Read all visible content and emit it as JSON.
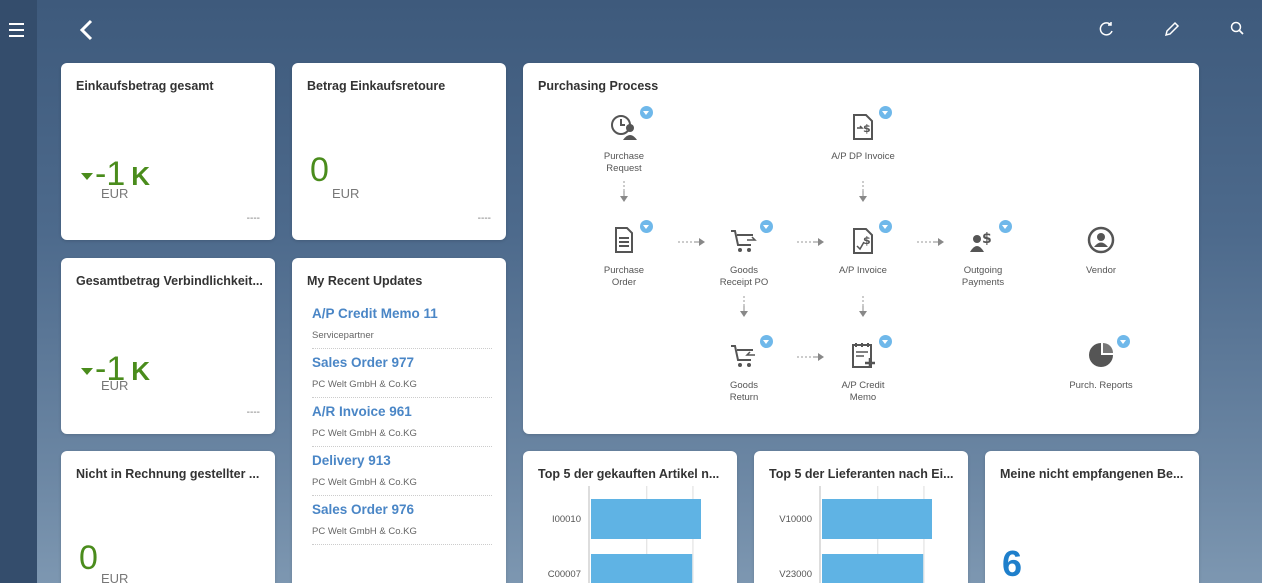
{
  "topbar": {
    "menu_icon": "hamburger-icon",
    "back_icon": "chevron-left-icon",
    "refresh_icon": "refresh-icon",
    "edit_icon": "pencil-icon",
    "search_icon": "search-icon"
  },
  "tiles": {
    "einkauf": {
      "title": "Einkaufsbetrag gesamt",
      "value": "-1",
      "scale": "K",
      "currency": "EUR",
      "footer": "----",
      "trend": "down"
    },
    "retoure": {
      "title": "Betrag Einkaufsretoure",
      "value": "0",
      "currency": "EUR",
      "footer": "----"
    },
    "verbind": {
      "title": "Gesamtbetrag Verbindlichkeit...",
      "value": "-1",
      "scale": "K",
      "currency": "EUR",
      "footer": "----",
      "trend": "down"
    },
    "nicht": {
      "title": "Nicht in Rechnung gestellter ...",
      "value": "0",
      "currency": "EUR"
    }
  },
  "recent": {
    "title": "My Recent Updates",
    "items": [
      {
        "title": "A/P Credit Memo 11",
        "sub": "Servicepartner"
      },
      {
        "title": "Sales Order 977",
        "sub": "PC Welt GmbH & Co.KG"
      },
      {
        "title": "A/R Invoice 961",
        "sub": "PC Welt GmbH & Co.KG"
      },
      {
        "title": "Delivery 913",
        "sub": "PC Welt GmbH & Co.KG"
      },
      {
        "title": "Sales Order 976",
        "sub": "PC Welt GmbH & Co.KG"
      }
    ]
  },
  "process": {
    "title": "Purchasing Process",
    "nodes": {
      "purchase_request": {
        "label": "Purchase\nRequest",
        "icon": "clock-person-icon"
      },
      "ap_dp_invoice": {
        "label": "A/P DP Invoice",
        "icon": "dp-invoice-icon"
      },
      "purchase_order": {
        "label": "Purchase\nOrder",
        "icon": "document-icon"
      },
      "goods_receipt": {
        "label": "Goods\nReceipt PO",
        "icon": "cart-in-icon"
      },
      "ap_invoice": {
        "label": "A/P Invoice",
        "icon": "invoice-icon"
      },
      "outgoing_payments": {
        "label": "Outgoing\nPayments",
        "icon": "payments-icon"
      },
      "vendor": {
        "label": "Vendor",
        "icon": "vendor-icon"
      },
      "goods_return": {
        "label": "Goods\nReturn",
        "icon": "cart-return-icon"
      },
      "ap_credit_memo": {
        "label": "A/P Credit\nMemo",
        "icon": "credit-memo-icon"
      },
      "purch_reports": {
        "label": "Purch. Reports",
        "icon": "pie-chart-icon"
      }
    }
  },
  "charts": {
    "artikel": {
      "title": "Top 5 der gekauften Artikel n...",
      "ticks": [
        "I00010",
        "C00007"
      ]
    },
    "lieferanten": {
      "title": "Top 5 der Lieferanten nach Ei...",
      "ticks": [
        "V10000",
        "V23000"
      ]
    },
    "meine": {
      "title": "Meine nicht empfangenen Be...",
      "value": "6"
    }
  },
  "chart_data": [
    {
      "type": "bar",
      "title": "Top 5 der gekauften Artikel n...",
      "categories": [
        "I00010",
        "C00007"
      ],
      "values": [
        100,
        92
      ]
    },
    {
      "type": "bar",
      "title": "Top 5 der Lieferanten nach Ei...",
      "categories": [
        "V10000",
        "V23000"
      ],
      "values": [
        100,
        92
      ]
    }
  ]
}
